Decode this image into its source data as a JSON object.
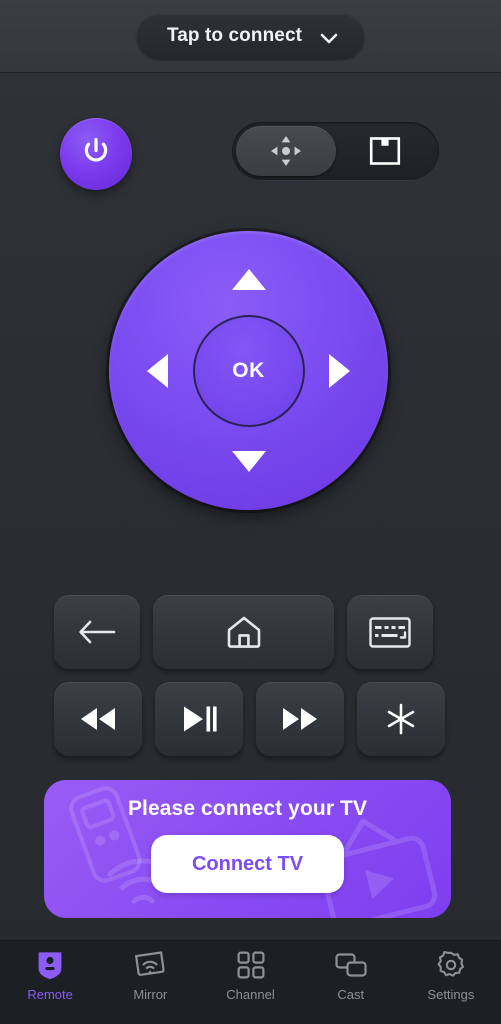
{
  "topbar": {
    "connect_label": "Tap to connect",
    "chevron_icon": "chevron-down-icon"
  },
  "controls": {
    "power_icon": "power-icon",
    "mode_toggle": {
      "options": [
        {
          "id": "dpad",
          "icon": "dpad-mode-icon",
          "active": true
        },
        {
          "id": "touchpad",
          "icon": "touchpad-mode-icon",
          "active": false
        }
      ]
    },
    "dpad": {
      "up_icon": "arrow-up-icon",
      "down_icon": "arrow-down-icon",
      "left_icon": "arrow-left-icon",
      "right_icon": "arrow-right-icon",
      "ok_label": "OK"
    },
    "buttons_row1": [
      {
        "id": "back",
        "icon": "back-arrow-icon"
      },
      {
        "id": "home",
        "icon": "home-icon"
      },
      {
        "id": "keyboard",
        "icon": "keyboard-icon"
      }
    ],
    "buttons_row2": [
      {
        "id": "rewind",
        "icon": "rewind-icon"
      },
      {
        "id": "play-pause",
        "icon": "play-pause-icon"
      },
      {
        "id": "fast-forward",
        "icon": "fast-forward-icon"
      },
      {
        "id": "options",
        "icon": "asterisk-icon"
      }
    ]
  },
  "banner": {
    "title": "Please connect your TV",
    "button_label": "Connect TV"
  },
  "bottom_nav": {
    "items": [
      {
        "label": "Remote",
        "icon": "remote-icon",
        "active": true
      },
      {
        "label": "Mirror",
        "icon": "mirror-icon",
        "active": false
      },
      {
        "label": "Channel",
        "icon": "channel-grid-icon",
        "active": false
      },
      {
        "label": "Cast",
        "icon": "cast-icon",
        "active": false
      },
      {
        "label": "Settings",
        "icon": "gear-icon",
        "active": false
      }
    ]
  },
  "colors": {
    "accent": "#7c3aed",
    "accent_light": "#8b5cf6",
    "background": "#2a2d32",
    "panel": "#34373c",
    "button": "#35383e",
    "nav_bg": "#1c1f24",
    "nav_inactive": "#8d9099",
    "white": "#ffffff"
  }
}
